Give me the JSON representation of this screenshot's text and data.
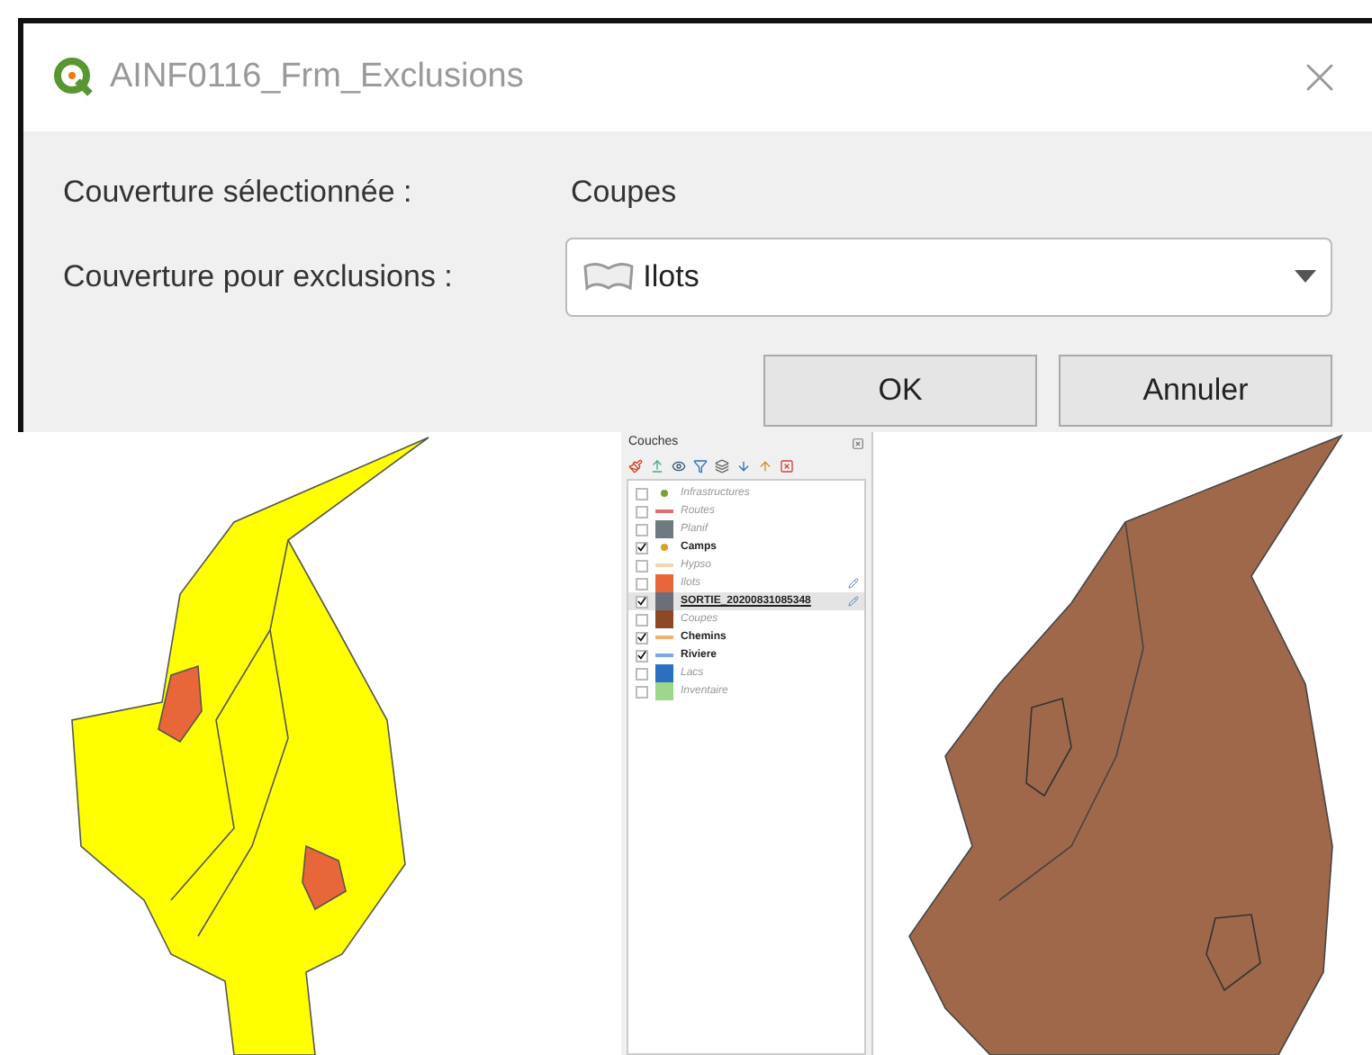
{
  "dialog": {
    "title": "AINF0116_Frm_Exclusions",
    "fields": [
      {
        "kind": "text",
        "label": "Couverture sélectionnée :",
        "value": "Coupes"
      },
      {
        "kind": "dropdown",
        "label": "Couverture pour exclusions :",
        "value": "Ilots"
      }
    ],
    "buttons": [
      "OK",
      "Annuler"
    ]
  },
  "layers_panel": {
    "title": "Couches",
    "layers": [
      {
        "name": "Infrastructures",
        "checked": false,
        "selected": false,
        "kind": "point",
        "color": "#7aa03c",
        "indicator": false
      },
      {
        "name": "Routes",
        "checked": false,
        "selected": false,
        "kind": "line",
        "color": "#e07070",
        "indicator": false
      },
      {
        "name": "Planif",
        "checked": false,
        "selected": false,
        "kind": "fill",
        "color": "#6f7a80",
        "indicator": false
      },
      {
        "name": "Camps",
        "checked": true,
        "selected": false,
        "kind": "point",
        "color": "#e0a020",
        "indicator": false
      },
      {
        "name": "Hypso",
        "checked": false,
        "selected": false,
        "kind": "line",
        "color": "#f0d8b0",
        "indicator": false
      },
      {
        "name": "Ilots",
        "checked": false,
        "selected": false,
        "kind": "fill",
        "color": "#e8673a",
        "indicator": true
      },
      {
        "name": "SORTIE_20200831085348",
        "checked": true,
        "selected": true,
        "kind": "fill",
        "color": "#6a6f7a",
        "indicator": true
      },
      {
        "name": "Coupes",
        "checked": false,
        "selected": false,
        "kind": "fill",
        "color": "#8b4a25",
        "indicator": false
      },
      {
        "name": "Chemins",
        "checked": true,
        "selected": false,
        "kind": "line",
        "color": "#f0b070",
        "indicator": false
      },
      {
        "name": "Riviere",
        "checked": true,
        "selected": false,
        "kind": "line",
        "color": "#7aa8e0",
        "indicator": false
      },
      {
        "name": "Lacs",
        "checked": false,
        "selected": false,
        "kind": "fill",
        "color": "#2a6fc0",
        "indicator": false
      },
      {
        "name": "Inventaire",
        "checked": false,
        "selected": false,
        "kind": "fill",
        "color": "#9bd88a",
        "indicator": false
      }
    ]
  }
}
